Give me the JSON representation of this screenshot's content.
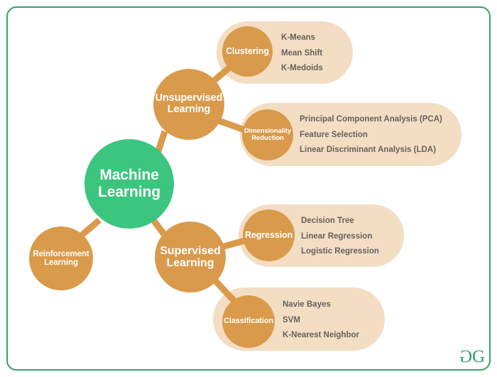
{
  "diagram": {
    "title": "Machine Learning",
    "frame_color": "#38a169",
    "root": {
      "label_line1": "Machine",
      "label_line2": "Learning",
      "color": "#3cc57e"
    },
    "branches": [
      {
        "id": "unsupervised",
        "label_line1": "Unsupervised",
        "label_line2": "Learning",
        "color": "#d99a4b"
      },
      {
        "id": "supervised",
        "label_line1": "Supervised",
        "label_line2": "Learning",
        "color": "#d99a4b"
      },
      {
        "id": "reinforcement",
        "label_line1": "Reinforcement",
        "label_line2": "Learning",
        "color": "#d99a4b"
      }
    ],
    "groups": [
      {
        "id": "clustering",
        "label_line1": "Clustering",
        "label_line2": "",
        "panel_color": "#f3ddc3",
        "circle_color": "#d99a4b",
        "items": [
          "K-Means",
          "Mean Shift",
          "K-Medoids"
        ]
      },
      {
        "id": "dimensionality-reduction",
        "label_line1": "Dimensionality",
        "label_line2": "Reduction",
        "panel_color": "#f3ddc3",
        "circle_color": "#d99a4b",
        "items": [
          "Principal Component Analysis (PCA)",
          "Feature Selection",
          "Linear Discriminant Analysis (LDA)"
        ]
      },
      {
        "id": "regression",
        "label_line1": "Regression",
        "label_line2": "",
        "panel_color": "#f3ddc3",
        "circle_color": "#d99a4b",
        "items": [
          "Decision Tree",
          "Linear Regression",
          "Logistic Regression"
        ]
      },
      {
        "id": "classification",
        "label_line1": "Classification",
        "label_line2": "",
        "panel_color": "#f3ddc3",
        "circle_color": "#d99a4b",
        "items": [
          "Navie Bayes",
          "SVM",
          "K-Nearest Neighbor"
        ]
      }
    ],
    "edge_color": "#d99a4b",
    "item_text_color": "#65625e"
  },
  "watermark": {
    "left_glyph": "G",
    "right_glyph": "G",
    "color": "#2f9e68"
  }
}
